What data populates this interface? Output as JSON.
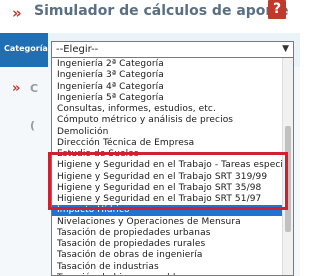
{
  "header": {
    "chevron": "»",
    "title": "Simulador de cálculos de aporte",
    "help_label": "?"
  },
  "form": {
    "category_label": "Categoría",
    "select_value": "--Elegir--",
    "arrow": "▼"
  },
  "background": {
    "chevron": "»",
    "partial_letter": "C",
    "partial_letter_2": "("
  },
  "dropdown": {
    "options": [
      "Ingeniería 2ª Categoría",
      "Ingeniería 3ª Categoría",
      "Ingeniería 4ª Categoría",
      "Ingeniería 5ª Categoría",
      "Consultas, informes, estudios, etc.",
      "Cómputo métrico y análisis de precios",
      "Demolición",
      "Dirección Técnica de Empresa",
      "Estudio de Suelos",
      "Higiene y Seguridad en el Trabajo - Tareas especificas",
      "Higiene y Seguridad en el Trabajo SRT 319/99",
      "Higiene y Seguridad en el Trabajo SRT 35/98",
      "Higiene y Seguridad en el Trabajo SRT 51/97",
      "Impacto Hídrico",
      "Nivelaciones y Operaciones de Mensura",
      "Tasación de propiedades urbanas",
      "Tasación de propiedades rurales",
      "Tasación de obras de ingeniería",
      "Tasación de industrias",
      "Tasación de bienes muebles"
    ],
    "selected_index": 13
  },
  "colors": {
    "accent": "#1f6fb2",
    "selected": "#1e74d0",
    "highlight_box": "#d01f2e",
    "brand_red": "#c0392b"
  }
}
